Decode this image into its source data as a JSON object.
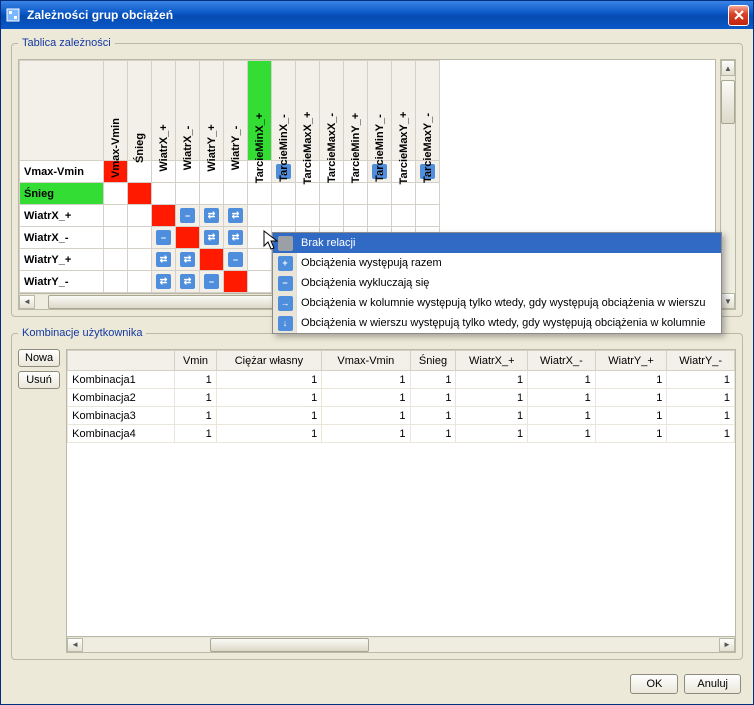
{
  "window": {
    "title": "Zależności grup obciążeń"
  },
  "matrix": {
    "legend": "Tablica zależności",
    "columns": [
      "Vmax-Vmin",
      "Śnieg",
      "WiatrX_+",
      "WiatrX_-",
      "WiatrY_+",
      "WiatrY_-",
      "TarcieMinX_+",
      "TarcieMinX_-",
      "TarcieMaxX_+",
      "TarcieMaxX_-",
      "TarcieMinY_+",
      "TarcieMinY_-",
      "TarcieMaxY_+",
      "TarcieMaxY_-"
    ],
    "highlight_col_index": 6,
    "highlight_row_index": 1,
    "rows": [
      {
        "label": "Vmax-Vmin",
        "cells": [
          "diag",
          "",
          "",
          "",
          "",
          "",
          "",
          "right",
          "",
          "",
          "",
          "right",
          "",
          "right"
        ]
      },
      {
        "label": "Śnieg",
        "cells": [
          "",
          "diag",
          "",
          "",
          "",
          "",
          "",
          "",
          "",
          "",
          "",
          "",
          "",
          ""
        ]
      },
      {
        "label": "WiatrX_+",
        "cells": [
          "",
          "",
          "diag",
          "minus",
          "both",
          "both",
          "",
          "",
          "",
          "",
          "",
          "",
          "",
          ""
        ]
      },
      {
        "label": "WiatrX_-",
        "cells": [
          "",
          "",
          "minus",
          "diag",
          "both",
          "both",
          "",
          "",
          "",
          "",
          "",
          "",
          "",
          ""
        ]
      },
      {
        "label": "WiatrY_+",
        "cells": [
          "",
          "",
          "both",
          "both",
          "diag",
          "minus",
          "",
          "",
          "",
          "",
          "",
          "",
          "",
          ""
        ]
      },
      {
        "label": "WiatrY_-",
        "cells": [
          "",
          "",
          "both",
          "both",
          "minus",
          "diag",
          "",
          "",
          "",
          "",
          "",
          "",
          "",
          ""
        ]
      }
    ]
  },
  "contextMenu": {
    "items": [
      {
        "icon": "none",
        "label": "Brak relacji"
      },
      {
        "icon": "plus",
        "label": "Obciążenia występują razem"
      },
      {
        "icon": "minus",
        "label": "Obciążenia wykluczają się"
      },
      {
        "icon": "right",
        "label": "Obciążenia w kolumnie występują tylko wtedy, gdy występują obciążenia w wierszu"
      },
      {
        "icon": "down",
        "label": "Obciążenia w wierszu występują tylko wtedy, gdy występują obciążenia w kolumnie"
      }
    ],
    "selected": 0
  },
  "combos": {
    "legend": "Kombinacje użytkownika",
    "buttons": {
      "new": "Nowa",
      "delete": "Usuń"
    },
    "columns": [
      "",
      "Vmin",
      "Ciężar własny",
      "Vmax-Vmin",
      "Śnieg",
      "WiatrX_+",
      "WiatrX_-",
      "WiatrY_+",
      "WiatrY_-"
    ],
    "rows": [
      {
        "name": "Kombinacja1",
        "values": [
          1,
          1,
          1,
          1,
          1,
          1,
          1,
          1
        ]
      },
      {
        "name": "Kombinacja2",
        "values": [
          1,
          1,
          1,
          1,
          1,
          1,
          1,
          1
        ]
      },
      {
        "name": "Kombinacja3",
        "values": [
          1,
          1,
          1,
          1,
          1,
          1,
          1,
          1
        ]
      },
      {
        "name": "Kombinacja4",
        "values": [
          1,
          1,
          1,
          1,
          1,
          1,
          1,
          1
        ]
      }
    ]
  },
  "footer": {
    "ok": "OK",
    "cancel": "Anuluj"
  }
}
